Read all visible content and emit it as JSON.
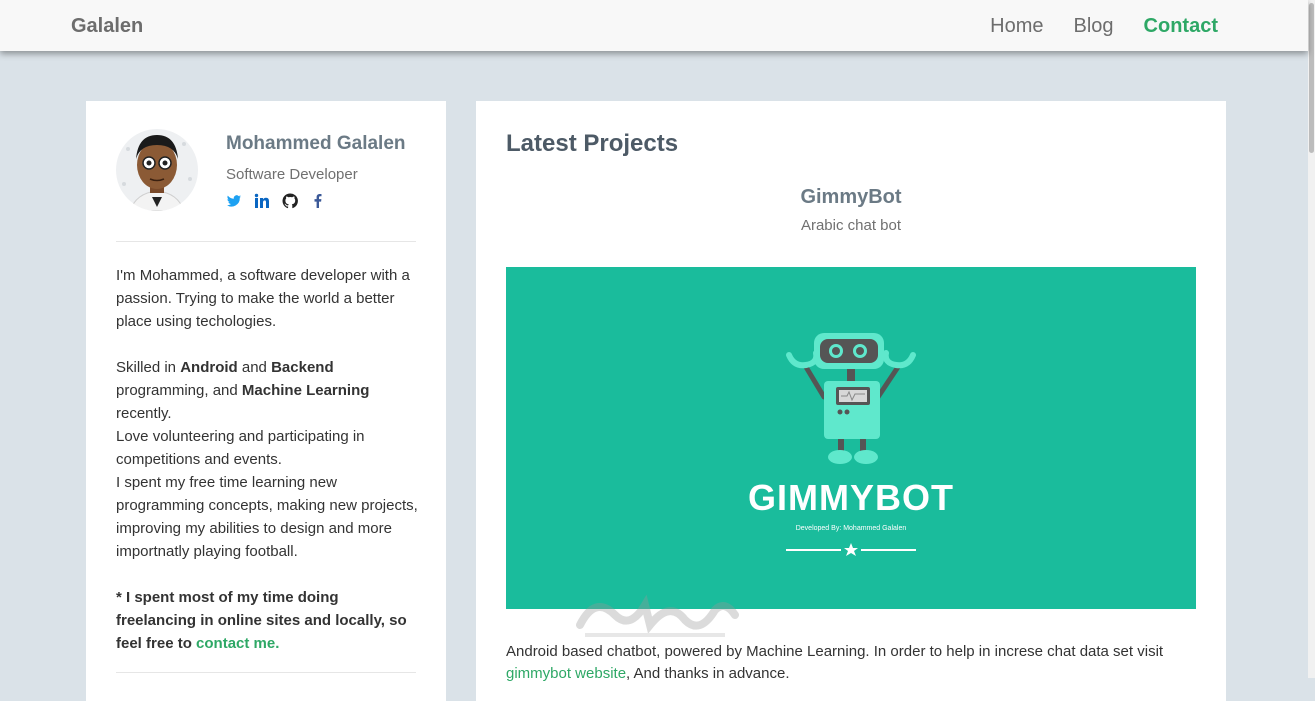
{
  "navbar": {
    "brand": "Galalen",
    "links": [
      "Home",
      "Blog",
      "Contact"
    ],
    "active": "Contact"
  },
  "profile": {
    "name": "Mohammed Galalen",
    "title": "Software Developer",
    "socials": [
      "twitter-icon",
      "linkedin-icon",
      "github-icon",
      "facebook-icon"
    ],
    "bio": {
      "intro": "I'm Mohammed, a software developer with a passion. Trying to make the world a better place using techologies.",
      "skilled_prefix": "Skilled in ",
      "skill_1": "Android",
      "and_1": " and ",
      "skill_2": "Backend",
      "programming_and": " programming, and ",
      "skill_3": "Machine Learning",
      "recently": " recently.",
      "volunteer": "Love volunteering and participating in competitions and events.",
      "free_time": "I spent my free time learning new programming concepts, making new projects, improving my abilities to design and more importnatly playing football.",
      "note": "* I spent most of my time doing freelancing in online sites and locally, so feel free to ",
      "contact_link": "contact me."
    }
  },
  "projects": {
    "heading": "Latest Projects",
    "items": [
      {
        "name": "GimmyBot",
        "subtitle": "Arabic chat bot",
        "banner_title": "GIMMYBOT",
        "banner_credit": "Developed By: Mohammed Galalen",
        "description_prefix": "Android based chatbot, powered by Machine Learning. In order to help in increse chat data set visit ",
        "link_text": "gimmybot website",
        "description_suffix": ", And thanks in advance."
      }
    ]
  },
  "colors": {
    "accent": "#2ea866",
    "banner": "#1abc9c",
    "background": "#dae2e8"
  }
}
